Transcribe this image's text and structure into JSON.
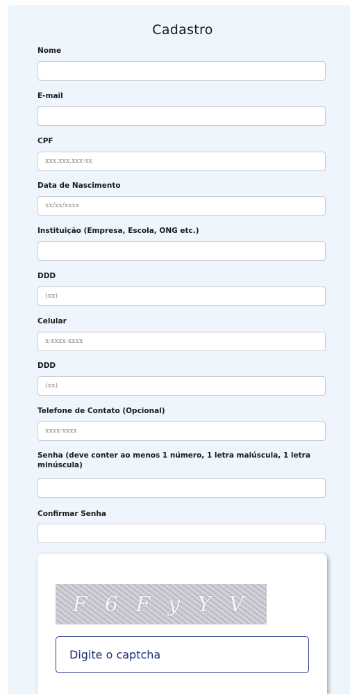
{
  "form": {
    "title": "Cadastro",
    "fields": {
      "nome": {
        "label": "Nome",
        "placeholder": ""
      },
      "email": {
        "label": "E-mail",
        "placeholder": ""
      },
      "cpf": {
        "label": "CPF",
        "placeholder": "xxx.xxx.xxx-xx"
      },
      "nascimento": {
        "label": "Data de Nascimento",
        "placeholder": "xx/xx/xxxx"
      },
      "instituicao": {
        "label": "Instituição (Empresa, Escola, ONG etc.)",
        "placeholder": ""
      },
      "ddd1": {
        "label": "DDD",
        "placeholder": "(xx)"
      },
      "celular": {
        "label": "Celular",
        "placeholder": "x-xxxx-xxxx"
      },
      "ddd2": {
        "label": "DDD",
        "placeholder": "(xx)"
      },
      "telefone": {
        "label": "Telefone de Contato (Opcional)",
        "placeholder": "xxxx-xxxx"
      },
      "senha": {
        "label": "Senha (deve conter ao menos 1 número, 1 letra maiúscula, 1 letra minúscula)",
        "placeholder": ""
      },
      "confirmar": {
        "label": "Confirmar Senha",
        "placeholder": ""
      }
    }
  },
  "captcha": {
    "text": "F 6 F y Y V",
    "input_placeholder": "Digite o captcha"
  }
}
